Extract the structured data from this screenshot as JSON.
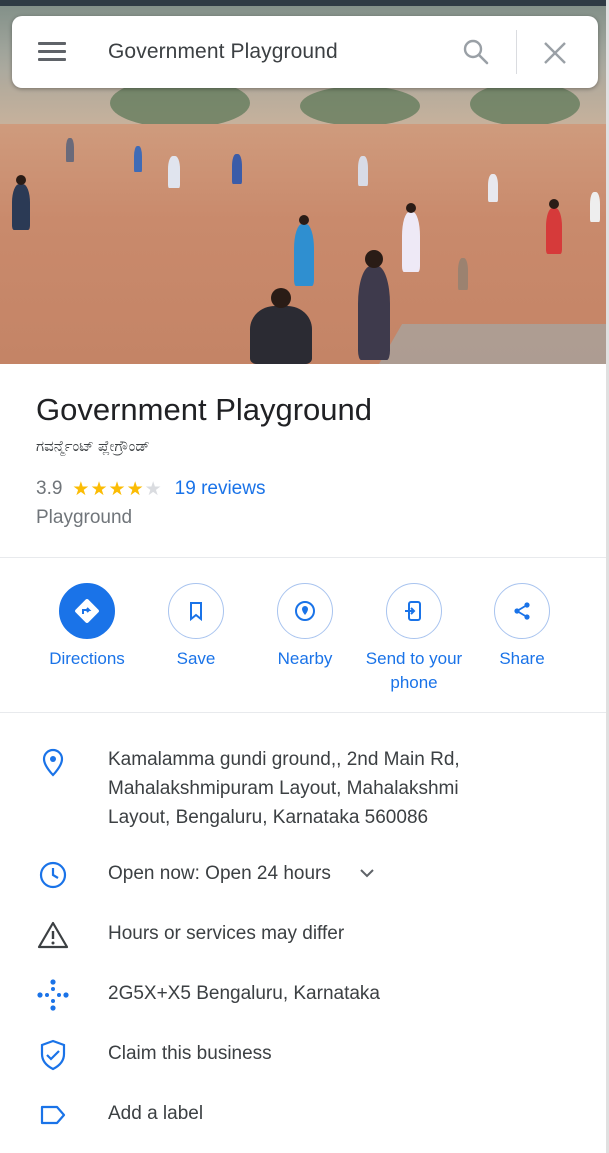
{
  "search": {
    "query": "Government Playground"
  },
  "place": {
    "name": "Government Playground",
    "local_name": "ಗವರ್ನ್ಮೆಂಟ್ ಪ್ಲೇಗ್ರೌಂಡ್",
    "rating": "3.9",
    "stars_filled": 4,
    "reviews": "19 reviews",
    "category": "Playground"
  },
  "actions": [
    {
      "label": "Directions",
      "icon": "directions-icon"
    },
    {
      "label": "Save",
      "icon": "bookmark-icon"
    },
    {
      "label": "Nearby",
      "icon": "nearby-icon"
    },
    {
      "label": "Send to your\nphone",
      "icon": "send-to-phone-icon"
    },
    {
      "label": "Share",
      "icon": "share-icon"
    }
  ],
  "details": {
    "address_line1": "Kamalamma gundi ground,, 2nd Main Rd,",
    "address_line2": "Mahalakshmipuram Layout, Mahalakshmi",
    "address_line3": "Layout, Bengaluru, Karnataka 560086",
    "hours": "Open now:  Open 24 hours",
    "hours_warning": "Hours or services may differ",
    "plus_code": "2G5X+X5 Bengaluru, Karnataka",
    "claim": "Claim this business",
    "label": "Add a label"
  },
  "colors": {
    "accent": "#1a73e8",
    "star": "#fbbc04",
    "text_secondary": "#70757a"
  }
}
